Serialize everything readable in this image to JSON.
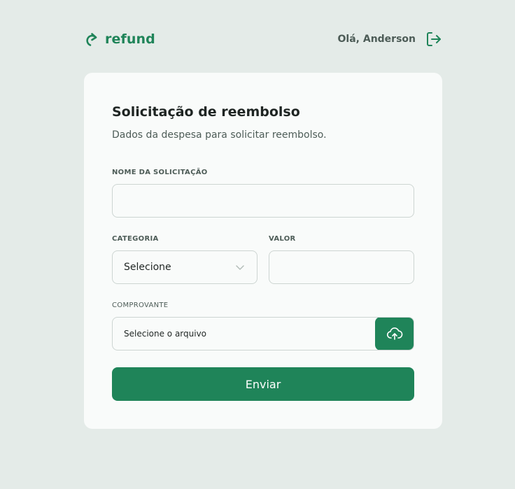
{
  "header": {
    "brand_name": "refund",
    "brand_icon": "redo-arrow-icon",
    "greeting": "Olá, Anderson",
    "logout_icon": "logout-icon"
  },
  "form": {
    "title": "Solicitação de reembolso",
    "subtitle": "Dados da despesa para solicitar reembolso.",
    "name_label": "NOME DA SOLICITAÇÃO",
    "name_value": "",
    "category_label": "CATEGORIA",
    "category_selected": "Selecione",
    "value_label": "VALOR",
    "value_value": "",
    "receipt_label": "COMPROVANTE",
    "receipt_placeholder": "Selecione o arquivo",
    "upload_icon": "cloud-upload-icon",
    "submit_label": "Enviar"
  },
  "colors": {
    "accent": "#1f8459",
    "background": "#e4ebe8",
    "card": "#f9fbfa",
    "text_muted": "#4d5c57"
  }
}
